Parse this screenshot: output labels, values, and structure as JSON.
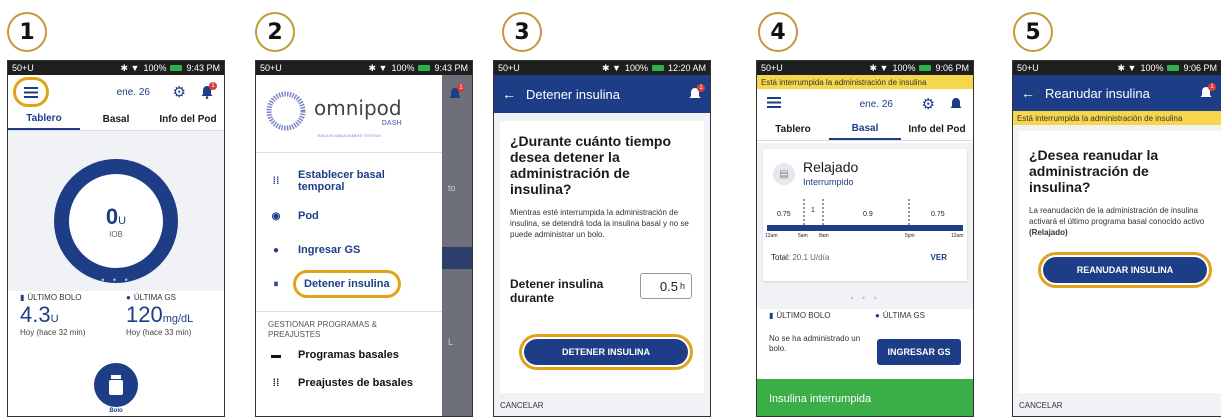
{
  "steps": [
    "1",
    "2",
    "3",
    "4",
    "5"
  ],
  "status": {
    "carrier": "50+U",
    "battery": "100%",
    "times": [
      "9:43 PM",
      "9:43 PM",
      "12:20 AM",
      "9:06 PM",
      "9:06 PM"
    ]
  },
  "phone1": {
    "date": "ene. 26",
    "tabs": [
      "Tablero",
      "Basal",
      "Info del Pod"
    ],
    "iob_value": "0",
    "iob_unit": "U",
    "iob_label": "IOB",
    "dots": "• • •",
    "last_bolus_label": "ÚLTIMO BOLO",
    "last_bolus_value": "4.3",
    "last_bolus_unit": "U",
    "last_bolus_time": "Hoy (hace 32 min)",
    "last_bg_label": "ÚLTIMA GS",
    "last_bg_value": "120",
    "last_bg_unit": "mg/dL",
    "last_bg_time": "Hoy (hace 33 min)",
    "bolus_label": "Bolo"
  },
  "phone2": {
    "brand": "omnipod",
    "brand_sub": "DASH",
    "brand_tag": "INSULIN MANAGEMENT SYSTEM",
    "menu": [
      "Establecer basal temporal",
      "Pod",
      "Ingresar GS",
      "Detener insulina"
    ],
    "section_label": "GESTIONAR PROGRAMAS & PREAJUSTES",
    "menu2": [
      "Programas basales",
      "Preajustes de basales"
    ],
    "peek_text": "to",
    "peek_text2": "L"
  },
  "phone3": {
    "title": "Detener insulina",
    "question": "¿Durante cuánto tiempo desea detener la administración de insulina?",
    "body": "Mientras esté interrumpida la administración de insulina, se detendrá toda la insulina basal y no se puede administrar un bolo.",
    "field_label": "Detener insulina durante",
    "field_value": "0.5",
    "field_unit": "h",
    "button": "DETENER INSULINA",
    "cancel": "CANCELAR"
  },
  "phone4": {
    "banner": "Está interrumpida la administración de insulina",
    "date": "ene. 26",
    "tabs": [
      "Tablero",
      "Basal",
      "Info del Pod"
    ],
    "program_name": "Relajado",
    "program_status": "Interrumpido",
    "rates": [
      "0.75",
      "1",
      "0.9",
      "0.75"
    ],
    "times": [
      "12am",
      "5am",
      "8am",
      "5pm",
      "12am"
    ],
    "total_label": "Total:",
    "total_value": "20.1 U/día",
    "view": "VER",
    "dots": "• • •",
    "last_bolus_label": "ÚLTIMO BOLO",
    "last_bolus_text": "No se ha administrado un bolo.",
    "last_bg_label": "ÚLTIMA GS",
    "enter_bg": "INGRESAR GS",
    "green_banner": "Insulina interrumpida"
  },
  "phone5": {
    "title": "Reanudar insulina",
    "banner": "Está interrumpida la administración de insulina",
    "question": "¿Desea reanudar la administración de insulina?",
    "body_a": "La reanudación de la administración de insulina activará el último programa basal conocido activo ",
    "body_b": "(Relajado)",
    "button": "REANUDAR INSULINA",
    "cancel": "CANCELAR"
  },
  "colors": {
    "accent": "#1d3d86",
    "highlight": "#e1a31c",
    "green": "#3cae48",
    "yellow": "#f6d64b"
  },
  "icons": [
    "hamburger-icon",
    "gear-icon",
    "bell-icon",
    "back-arrow-icon",
    "drop-icon",
    "vial-icon"
  ]
}
